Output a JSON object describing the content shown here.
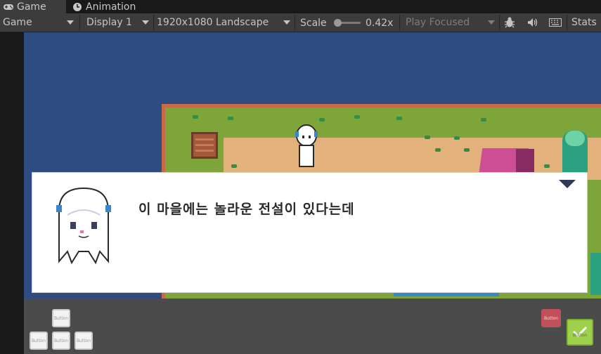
{
  "tabs": [
    {
      "label": "Game",
      "icon": "gamepad-icon",
      "active": true
    },
    {
      "label": "Animation",
      "icon": "clock-icon",
      "active": false
    }
  ],
  "toolbar": {
    "game_view": "Game",
    "display": "Display 1",
    "resolution": "1920x1080 Landscape",
    "scale_label": "Scale",
    "scale_value": "0.42x",
    "play_mode": "Play Focused",
    "stats": "Stats"
  },
  "dialog": {
    "text": "이 마을에는 놀라운 전설이 있다는데"
  },
  "controls": {
    "up": "Button",
    "left": "Button",
    "down": "Button",
    "right": "Button",
    "cancel": "Button",
    "confirm": "Button"
  },
  "colors": {
    "viewport_bg": "#2e4b82",
    "grass": "#7ea53a",
    "dirt": "#e3b27c",
    "confirm": "#9fd14c",
    "cancel": "#c0505a"
  }
}
